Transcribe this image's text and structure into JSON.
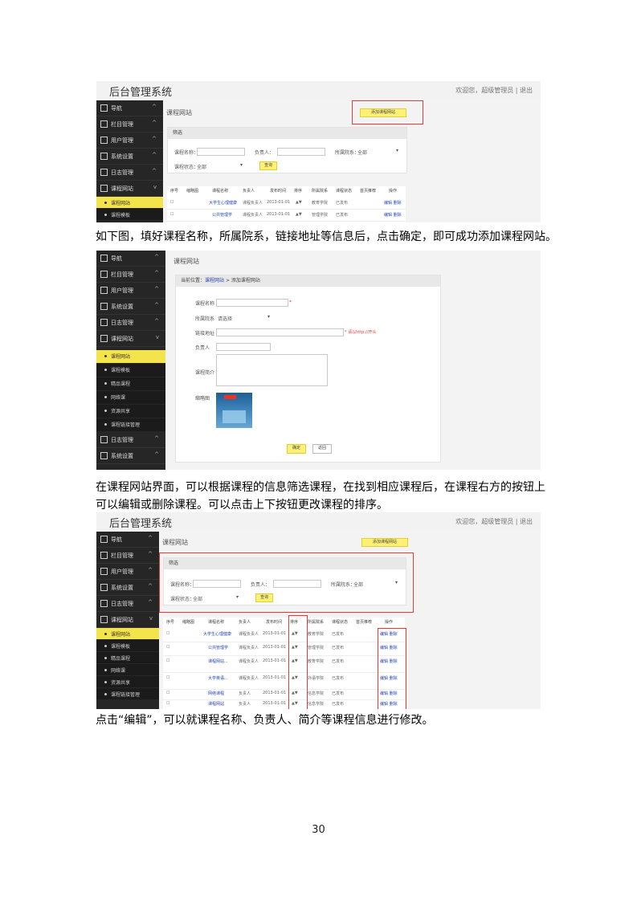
{
  "paragraphs": {
    "p1": "如下图，填好课程名称，所属院系，链接地址等信息后，点击确定，即可成功添加课程网站。",
    "p2a": "在课程网站界面，可以根据课程的信息筛选课程，在找到相应课程后，在课程右方的按钮上",
    "p2b": "可以编辑或删除课程。可以点击上下按钮更改课程的排序。",
    "p3": "点击“编辑”，可以就课程名称、负责人、简介等课程信息进行修改。"
  },
  "page_number": "30",
  "admin": {
    "brand": "后台管理系统",
    "user_info": "欢迎您，超级管理员 | 退出",
    "page_title": "课程网站",
    "add_button": "添加课程网站",
    "filter_panel": {
      "title": "筛选",
      "course_name_label": "课程名称：",
      "leader_label": "负责人：",
      "dept_label": "所属院系：",
      "dept_value": "全部",
      "status_label": "课程状态：",
      "status_value": "全部",
      "query_button": "查询"
    },
    "sidebar": [
      "导航",
      "栏目管理",
      "用户管理",
      "系统设置",
      "日志管理",
      "课程网站"
    ],
    "sidebar_sub": [
      "课程网站",
      "课程模板",
      "精品课程",
      "网络课",
      "资源共享",
      "课程链接管理"
    ],
    "table_headers": [
      "序号",
      "缩略图",
      "课程名称",
      "负责人",
      "发布时间",
      "排序",
      "所属院系",
      "课程状态",
      "首页推荐",
      "操作"
    ],
    "rows_a": [
      {
        "name": "大学生心理健康",
        "leader": "课程负责人",
        "date": "2013-01-01",
        "dept": "教育学院",
        "status": "已发布",
        "ops": "编辑 删除"
      },
      {
        "name": "公共管理学",
        "leader": "课程负责人",
        "date": "2013-01-01",
        "dept": "管理学院",
        "status": "已发布",
        "ops": "编辑 删除"
      }
    ],
    "rows_b": [
      {
        "name": "大学生心理健康",
        "leader": "课程负责人",
        "date": "2013-01-01",
        "dept": "教育学院",
        "status": "已发布",
        "ops": "编辑 删除"
      },
      {
        "name": "公共管理学",
        "leader": "课程负责人",
        "date": "2013-01-01",
        "dept": "管理学院",
        "status": "已发布",
        "ops": "编辑 删除"
      },
      {
        "name": "课程网站...",
        "leader": "课程负责人",
        "date": "2013-01-01",
        "dept": "教育学院",
        "status": "已发布",
        "ops": "编辑 删除"
      },
      {
        "name": "大学英语...",
        "leader": "课程负责人",
        "date": "2013-01-01",
        "dept": "外语学院",
        "status": "已发布",
        "ops": "编辑 删除"
      },
      {
        "name": "网络课程",
        "leader": "负责人",
        "date": "2013-01-01",
        "dept": "信息学院",
        "status": "已发布",
        "ops": "编辑 删除"
      },
      {
        "name": "课程网站",
        "leader": "负责人",
        "date": "2013-01-01",
        "dept": "信息学院",
        "status": "已发布",
        "ops": "编辑 删除"
      }
    ]
  },
  "add_form": {
    "page_title": "课程网站",
    "breadcrumb_prefix": "当前位置：",
    "breadcrumb_link": "课程网站",
    "breadcrumb_current": " > 添加课程网站",
    "name_label": "课程名称",
    "dept_label": "所属院系",
    "dept_value": "请选择",
    "url_label": "链接地址",
    "url_hint": "* 请以http://开头",
    "leader_label": "负责人",
    "intro_label": "课程简介",
    "image_label": "缩略图",
    "confirm_button": "确定",
    "back_button": "返回"
  }
}
